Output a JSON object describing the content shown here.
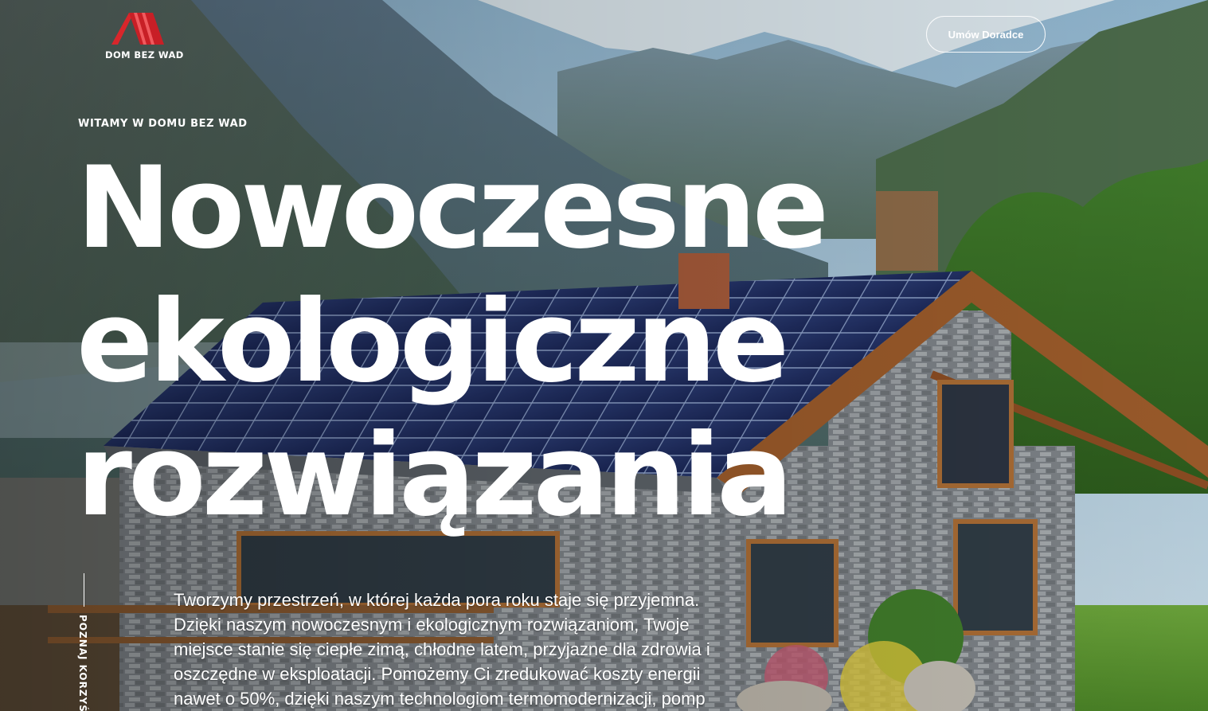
{
  "header": {
    "logo_text": "DOM BEZ WAD",
    "cta_label": "Umów Doradce"
  },
  "hero": {
    "eyebrow": "WITAMY W DOMU BEZ WAD",
    "headline": [
      "Nowoczesne",
      "ekologiczne",
      "rozwiązania"
    ],
    "intro": "Tworzymy przestrzeń, w której każda pora roku staje się przyjemna. Dzięki naszym nowoczesnym i ekologicznym rozwiązaniom, Twoje miejsce stanie się ciepłe zimą, chłodne latem, przyjazne dla zdrowia i oszczędne w eksploatacji. Pomożemy Ci zredukować koszty energii nawet o 50%, dzięki naszym technologiom termomodernizacji, pomp",
    "side_link": "POZNAJ KORZYŚ"
  },
  "colors": {
    "brand_red": "#d8262b",
    "text": "#ffffff"
  }
}
